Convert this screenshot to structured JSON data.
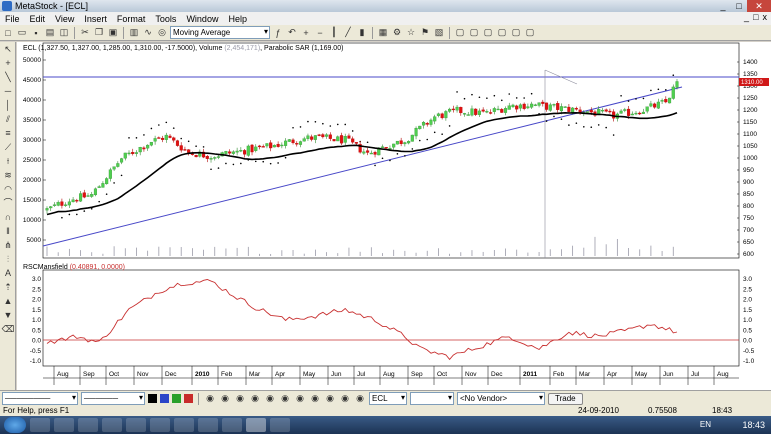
{
  "window": {
    "title": "MetaStock - [ECL]",
    "controls": [
      "_",
      "□",
      "✕"
    ]
  },
  "menu": {
    "items": [
      "File",
      "Edit",
      "View",
      "Insert",
      "Format",
      "Tools",
      "Window",
      "Help"
    ],
    "mdi_controls": [
      "_",
      "□",
      "x"
    ]
  },
  "toolbar": {
    "indicator_combo": "Moving Average"
  },
  "price_pane": {
    "title_prefix": "ECL (1,327.50, 1,327.00, 1,285.00, 1,310.00, -17.5000), Volume ",
    "volume_value": "(2,454,171)",
    "title_suffix": ", Parabolic SAR (1,169.00)",
    "last_price_label": "1310.00",
    "right_axis": [
      "1400",
      "1350",
      "1300",
      "1250",
      "1200",
      "1150",
      "1100",
      "1050",
      "1000",
      "950",
      "900",
      "850",
      "800",
      "750",
      "700",
      "650",
      "600"
    ],
    "left_axis": [
      "50000",
      "45000",
      "40000",
      "35000",
      "30000",
      "25000",
      "20000",
      "15000",
      "10000",
      "5000"
    ]
  },
  "indicator_pane": {
    "title_prefix": "RSCMansfield ",
    "title_values": "(0.40891, 0.0000)",
    "right_axis": [
      "3.0",
      "2.5",
      "2.0",
      "1.5",
      "1.0",
      "0.5",
      "0.0",
      "-0.5",
      "-1.0"
    ],
    "left_axis": [
      "3.0",
      "2.5",
      "2.0",
      "1.5",
      "1.0",
      "0.5",
      "0.0",
      "-0.5",
      "-1.0"
    ]
  },
  "x_axis": [
    {
      "label": "Aug",
      "bold": false
    },
    {
      "label": "Sep",
      "bold": false
    },
    {
      "label": "Oct",
      "bold": false
    },
    {
      "label": "Nov",
      "bold": false
    },
    {
      "label": "Dec",
      "bold": false
    },
    {
      "label": "2010",
      "bold": true
    },
    {
      "label": "Feb",
      "bold": false
    },
    {
      "label": "Mar",
      "bold": false
    },
    {
      "label": "Apr",
      "bold": false
    },
    {
      "label": "May",
      "bold": false
    },
    {
      "label": "Jun",
      "bold": false
    },
    {
      "label": "Jul",
      "bold": false
    },
    {
      "label": "Aug",
      "bold": false
    },
    {
      "label": "Sep",
      "bold": false
    },
    {
      "label": "Oct",
      "bold": false
    },
    {
      "label": "Nov",
      "bold": false
    },
    {
      "label": "Dec",
      "bold": false
    },
    {
      "label": "2011",
      "bold": true
    },
    {
      "label": "Feb",
      "bold": false
    },
    {
      "label": "Mar",
      "bold": false
    },
    {
      "label": "Apr",
      "bold": false
    },
    {
      "label": "May",
      "bold": false
    },
    {
      "label": "Jun",
      "bold": false
    },
    {
      "label": "Jul",
      "bold": false
    },
    {
      "label": "Aug",
      "bold": false
    }
  ],
  "bottom_toolbar": {
    "symbol": "ECL",
    "vendor": "<No Vendor>",
    "trade_button": "Trade"
  },
  "status": {
    "help": "For Help, press F1",
    "date": "24-09-2010",
    "value": "0.75508",
    "time": "18:43"
  },
  "taskbar": {
    "lang": "EN",
    "clock": "18:43"
  },
  "colors": {
    "up": "#4fcf4f",
    "down": "#e01010",
    "ma": "#000000",
    "trend": "#4848c8",
    "rsc": "#c83030",
    "sar": "#000000"
  },
  "chart_data": {
    "type": "candlestick",
    "price_range": [
      600,
      1420
    ],
    "indicator_range": [
      -1.25,
      3.1
    ],
    "series": [
      {
        "name": "ECL",
        "type": "candlestick"
      },
      {
        "name": "Moving Average",
        "type": "line"
      },
      {
        "name": "Parabolic SAR",
        "type": "dots"
      },
      {
        "name": "RSCMansfield",
        "type": "line"
      }
    ],
    "last_close": 1310.0,
    "sar": 1169.0,
    "rsc_last": 0.40891
  }
}
